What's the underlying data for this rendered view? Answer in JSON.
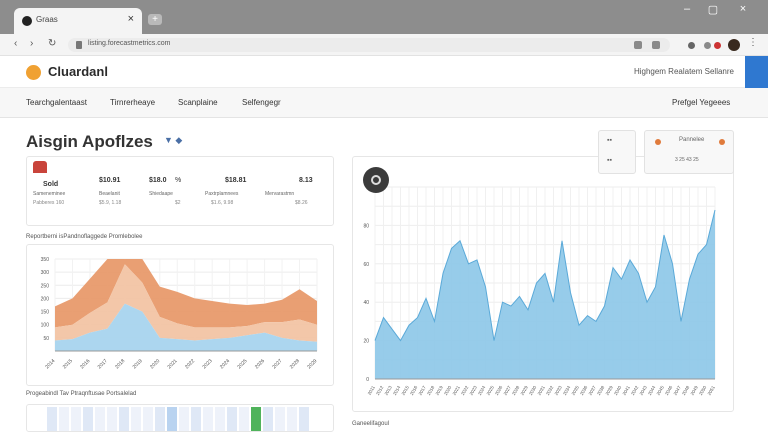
{
  "browser": {
    "tab_title": "Graas",
    "tab_close": "×",
    "new_tab": "+",
    "url": "listing.forecastmetrics.com",
    "window_controls": [
      "–",
      "▢",
      "×"
    ]
  },
  "app": {
    "brand": "Cluardanl",
    "header_right": "Highgem Realatem Sellanre"
  },
  "menu": {
    "items": [
      "Tearchgalentaast",
      "Tirnrerheaye",
      "Scanplaine",
      "Selfengegr"
    ],
    "right": "Prefgel Yegeees"
  },
  "page": {
    "title": "Aisgin Apoflzes",
    "title_icons": "▼ ◆"
  },
  "stats": [
    {
      "value": "Sold",
      "sub": "",
      "label": "Sameneminee",
      "sublabel": "Pabberes 160"
    },
    {
      "value": "$10.91",
      "sub": "",
      "label": "Beaelanit",
      "sublabel": "$5.9, 1.18"
    },
    {
      "value": "$18.0",
      "sub": "%",
      "label": "Shiedaape",
      "sublabel": "$2"
    },
    {
      "value": "$18.81",
      "sub": "",
      "label": "Paxtrplamnees",
      "sublabel": "$1.6, 9.98"
    },
    {
      "value": "8.13",
      "sub": "",
      "label": "Mervarastmn",
      "sublabel": "$8.26"
    }
  ],
  "left_chart_section": "Reportberni isPandnoflaggede Promlebolee",
  "left_bottom_section": "Progeabindl Tav Ptraqnftusae Portsalelad",
  "right_bottom_label": "Ganeelifagoul",
  "panel_controls": {
    "label": "Pannelee",
    "sub": "3 25 43 25"
  },
  "colors": {
    "area_top": "#e89a6b",
    "area_mid": "#f2c4a4",
    "area_bottom": "#a8d4ee",
    "bar_fill": "#8cc6e8",
    "highlight_green": "#4fb35b",
    "accent_blue": "#2f78d0"
  },
  "chart_data": [
    {
      "type": "area",
      "title": "Reportberni isPandnoflaggede Promlebolee",
      "y_ticks": [
        "350",
        "300",
        "250",
        "200",
        "150",
        "100",
        "50"
      ],
      "ylim": [
        0,
        350
      ],
      "x": [
        "2014",
        "2015",
        "2016",
        "2017",
        "2018",
        "2019",
        "2020",
        "2021",
        "2022",
        "2023",
        "2024",
        "2025",
        "2026",
        "2027",
        "2028",
        "2029"
      ],
      "series": [
        {
          "values": [
            40,
            45,
            70,
            85,
            180,
            150,
            50,
            45,
            40,
            45,
            50,
            60,
            70,
            50,
            40,
            35
          ]
        },
        {
          "values": [
            50,
            55,
            75,
            100,
            150,
            110,
            80,
            60,
            50,
            45,
            40,
            35,
            40,
            60,
            80,
            65
          ]
        },
        {
          "values": [
            80,
            100,
            130,
            175,
            155,
            125,
            115,
            120,
            110,
            100,
            90,
            80,
            70,
            85,
            115,
            90
          ]
        }
      ],
      "legend": "none",
      "grid": true
    },
    {
      "type": "area",
      "title": "",
      "y_ticks": [
        "80",
        "60",
        "40",
        "20",
        "0"
      ],
      "ylim": [
        0,
        100
      ],
      "x": [
        "2011",
        "2012",
        "2013",
        "2014",
        "2015",
        "2016",
        "2017",
        "2018",
        "2019",
        "2020",
        "2021",
        "2022",
        "2023",
        "2024",
        "2025",
        "2026",
        "2027",
        "2028",
        "2029",
        "2030",
        "2031",
        "2032",
        "2033",
        "2034",
        "2035",
        "2036",
        "2037",
        "2038",
        "2039",
        "2040",
        "2041",
        "2042",
        "2043",
        "2044",
        "2045",
        "2046",
        "2047",
        "2048",
        "2049",
        "2050",
        "2051"
      ],
      "values": [
        20,
        32,
        26,
        20,
        28,
        32,
        42,
        30,
        55,
        68,
        72,
        60,
        62,
        48,
        20,
        40,
        38,
        43,
        36,
        50,
        55,
        40,
        72,
        45,
        28,
        33,
        30,
        38,
        58,
        52,
        62,
        55,
        40,
        48,
        75,
        60,
        30,
        52,
        65,
        70,
        88
      ],
      "color": "#8cc6e8",
      "legend": "none",
      "grid": true
    }
  ]
}
